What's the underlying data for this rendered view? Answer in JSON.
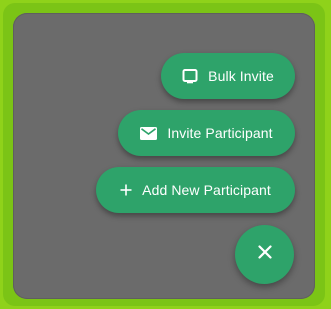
{
  "colors": {
    "outer_background": "#8fd21a",
    "panel_background": "#6b6b6b",
    "accent": "#2ea36a",
    "text": "#ffffff"
  },
  "speed_dial": {
    "actions": [
      {
        "label": "Bulk Invite",
        "icon": "tablet-icon"
      },
      {
        "label": "Invite Participant",
        "icon": "envelope-icon"
      },
      {
        "label": "Add New Participant",
        "icon": "plus-icon"
      }
    ],
    "main_button": {
      "icon": "close-icon",
      "glyph": "✕"
    }
  }
}
